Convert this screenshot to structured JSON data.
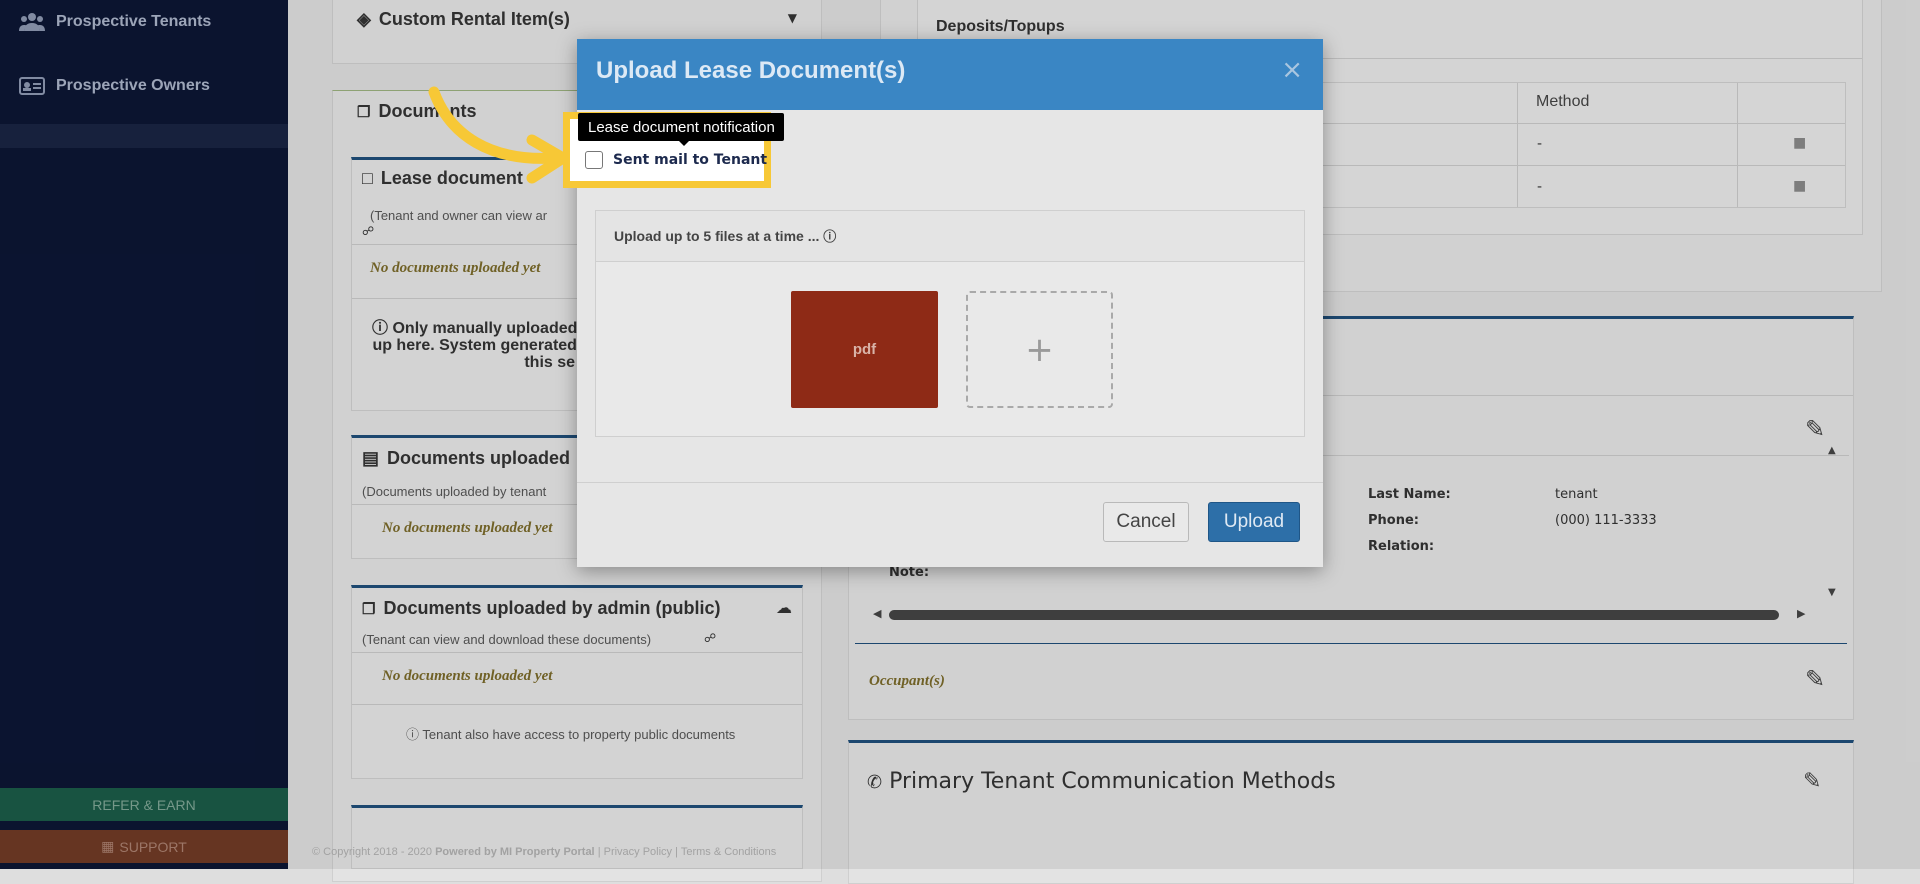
{
  "sidebar": {
    "items": [
      {
        "label": "Prospective Tenants",
        "icon": "users-icon"
      },
      {
        "label": "Prospective Owners",
        "icon": "id-card-icon"
      }
    ],
    "refer_label": "REFER & EARN",
    "support_label": "SUPPORT"
  },
  "left_column": {
    "custom_rental_title": "Custom Rental Item(s)",
    "documents_tab": "Documents",
    "lease_documents": {
      "title": "Lease document",
      "subtitle": "(Tenant and owner can view ar",
      "empty": "No documents uploaded yet",
      "note_line1": "Only manually uploaded",
      "note_line2": "up here. System generated",
      "note_line3": "this se"
    },
    "tenant_documents": {
      "title": "Documents uploaded",
      "subtitle": "(Documents uploaded by tenant",
      "empty": "No documents uploaded yet"
    },
    "admin_public_documents": {
      "title": "Documents uploaded by admin (public)",
      "subtitle": "(Tenant can view and download these documents)",
      "empty": "No documents uploaded yet",
      "note": "Tenant also have access to property public documents"
    }
  },
  "right_column": {
    "deposits_title": "Deposits/Topups",
    "method_header": "Method",
    "method_values": [
      "-",
      "-"
    ],
    "last_name_label": "Last Name:",
    "last_name_value": "tenant",
    "phone_label": "Phone:",
    "phone_value": "(000) 111-3333",
    "relation_label": "Relation:",
    "note_label": "Note:",
    "occupants_label": "Occupant(s)",
    "communication_title": "Primary Tenant Communication Methods"
  },
  "footer": {
    "copyright_a": "© Copyright 2018 - 2020",
    "powered": "Powered by MI Property Portal",
    "links": "| Privacy Policy | Terms & Conditions"
  },
  "modal": {
    "title": "Upload Lease Document(s)",
    "close_symbol": "×",
    "tooltip": "Lease document notification",
    "checkbox_label": "Sent mail to Tenant",
    "checkbox_checked": false,
    "upload_hint": "Upload up to 5 files at a time ...",
    "pdf_tile_label": "pdf",
    "add_symbol": "+",
    "cancel_label": "Cancel",
    "upload_label": "Upload"
  },
  "colors": {
    "highlight": "#f7c836",
    "modal_header": "#3a86c4",
    "primary_button": "#2d6fa8"
  }
}
